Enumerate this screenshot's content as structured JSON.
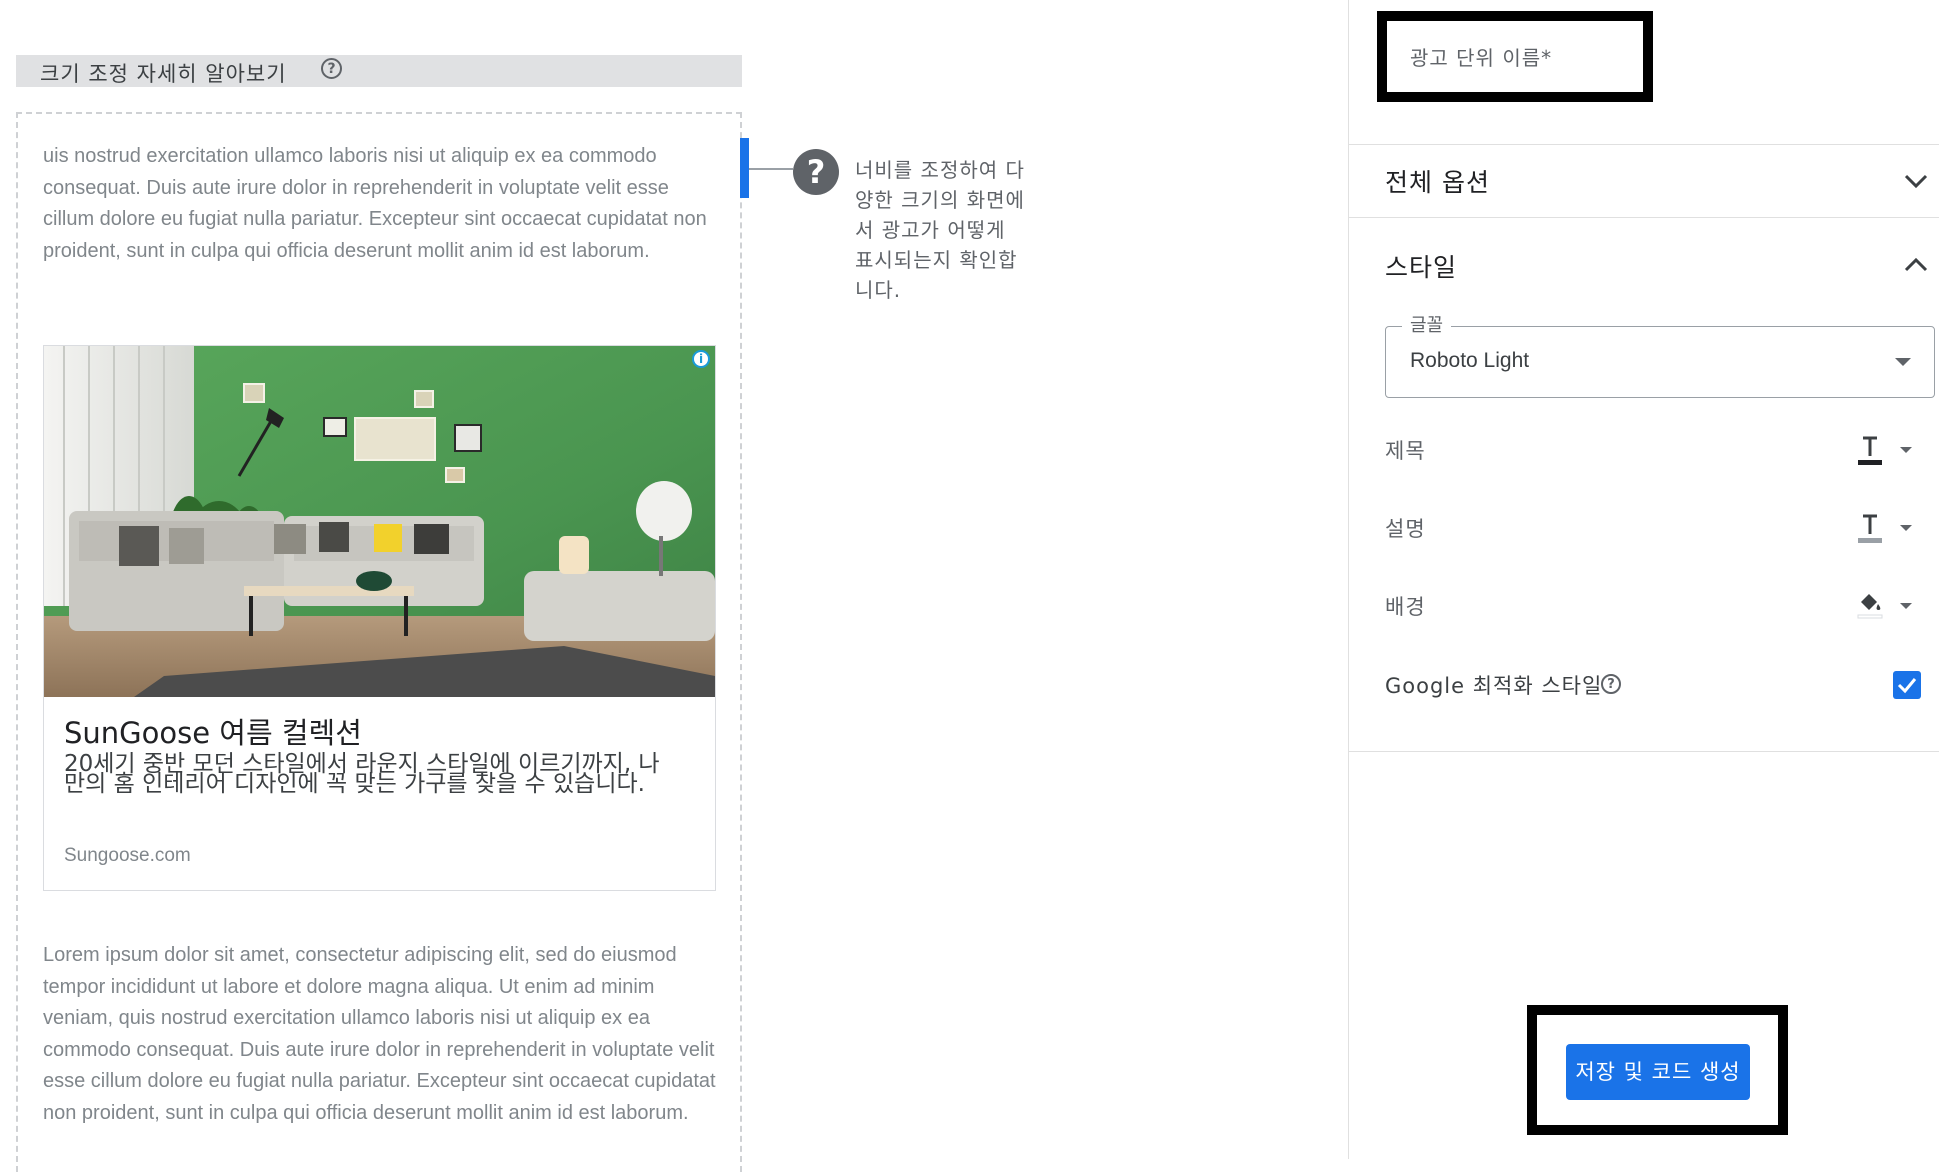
{
  "preview": {
    "resize_label": "크기 조정 자세히 알아보기",
    "resize_help": "?",
    "tooltip_text": "너비를 조정하여 다양한 크기의 화면에서 광고가 어떻게 표시되는지 확인합니다.",
    "lorem_top": "uis nostrud exercitation ullamco laboris nisi ut aliquip ex ea commodo consequat. Duis aute irure dolor in reprehenderit in voluptate velit esse cillum dolore eu fugiat nulla pariatur. Excepteur sint occaecat cupidatat non proident, sunt in culpa qui officia deserunt mollit anim id est laborum.",
    "lorem_bottom": "Lorem ipsum dolor sit amet, consectetur adipiscing elit, sed do eiusmod tempor incididunt ut labore et dolore magna aliqua. Ut enim ad minim veniam, quis nostrud exercitation ullamco laboris nisi ut aliquip ex ea commodo consequat. Duis aute irure dolor in reprehenderit in voluptate velit esse cillum dolore eu fugiat nulla pariatur. Excepteur sint occaecat cupidatat non proident, sunt in culpa qui officia deserunt mollit anim id est laborum.",
    "ad": {
      "title": "SunGoose 여름 컬렉션",
      "description": "20세기 중반 모던 스타일에서 라운지 스타일에 이르기까지, 나만의 홈 인테리어 디자인에 꼭 맞는 가구를 찾을 수 있습니다.",
      "url": "Sungoose.com",
      "info_icon": "i"
    }
  },
  "panel": {
    "ad_unit_name_label": "광고 단위 이름*",
    "all_options": "전체 옵션",
    "style": "스타일",
    "font_legend": "글꼴",
    "font_value": "Roboto Light",
    "title_label": "제목",
    "description_label": "설명",
    "background_label": "배경",
    "google_optimized_label": "Google 최적화 스타일",
    "google_optimized_checked": true,
    "save_button": "저장 및 코드 생성"
  },
  "colors": {
    "accent": "#1a73e8",
    "highlight_border": "#000000",
    "wall_green": "#4e9a52"
  }
}
